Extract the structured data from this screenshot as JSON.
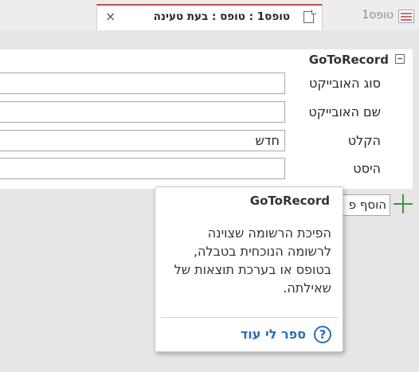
{
  "tabs": {
    "active": {
      "title": "טופס1 : טופס : בעת טעינה",
      "close_glyph": "×",
      "icon": "form-icon"
    },
    "inactive": {
      "title": "טופס1",
      "icon": "datasheet-icon"
    }
  },
  "macro": {
    "action_name": "GoToRecord",
    "collapse_icon": "collapse-icon",
    "arguments": [
      {
        "label": "סוג האובייקט",
        "value": ""
      },
      {
        "label": "שם האובייקט",
        "value": ""
      },
      {
        "label": "הקלט",
        "value": "חדש"
      },
      {
        "label": "היסט",
        "value": ""
      }
    ],
    "add_action": {
      "value": "הוסף פ",
      "icon": "plus-icon"
    }
  },
  "tooltip": {
    "title": "GoToRecord",
    "body": "הפיכת הרשומה שצוינה לרשומה הנוכחית בטבלה, בטופס או בערכת תוצאות של שאילתה.",
    "link_label": "ספר לי עוד",
    "link_icon_glyph": "?",
    "link_icon": "help-circle-icon"
  },
  "colors": {
    "active_tab_accent": "#c0504d",
    "link": "#2b6cb5",
    "add_icon": "#3a9a3a"
  }
}
